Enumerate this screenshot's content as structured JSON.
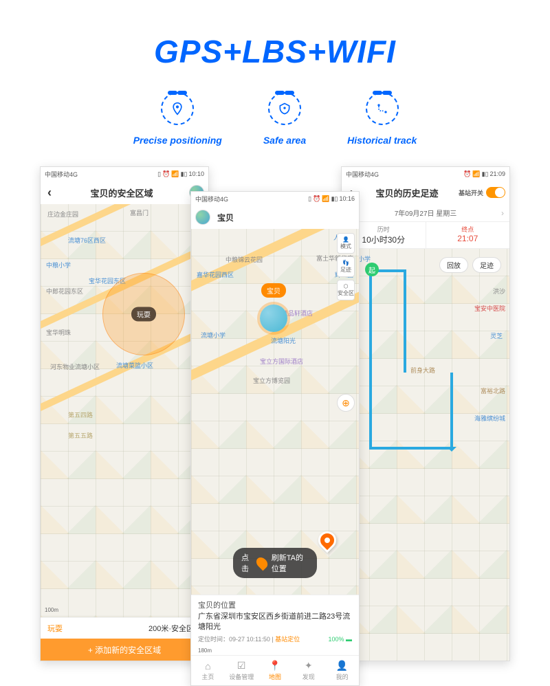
{
  "hero": {
    "title": "GPS+LBS+WIFI"
  },
  "features": [
    {
      "label": "Precise positioning"
    },
    {
      "label": "Safe area"
    },
    {
      "label": "Historical track"
    }
  ],
  "phone_left": {
    "status": {
      "carrier": "中国移动4G",
      "time": "10:10"
    },
    "title": "宝贝的安全区域",
    "map_labels": [
      "庄边金庄园",
      "富昌门",
      "流塘76区西区",
      "中粮小学",
      "中郎花园东区",
      "宝华花园东区",
      "宝华明珠",
      "河东物业流塘小区",
      "流塘菜篮小区",
      "第五四路",
      "第五五路"
    ],
    "pin_label": "玩耍",
    "scale": "100m",
    "zone": {
      "name": "玩耍",
      "desc": "200米·安全区域"
    },
    "add_btn": "+ 添加新的安全区域"
  },
  "phone_center": {
    "status": {
      "carrier": "中国移动4G",
      "time": "10:16"
    },
    "avatar_name": "宝贝",
    "map_labels": [
      "人人乐",
      "嘉华花园西区",
      "中粮锦云花园",
      "流塘小学",
      "宝贝",
      "桂品轩酒店",
      "流塘阳光",
      "宝立方国际酒店",
      "宝立方博览园",
      "辉公园",
      "富土华新华府"
    ],
    "dev_bubble": "宝贝",
    "side_ctrls": [
      "模式",
      "足迹",
      "安全区"
    ],
    "refresh_pill": {
      "left": "点击",
      "right": "刷新TA的位置"
    },
    "addr": {
      "title": "宝贝的位置",
      "text": "广东省深圳市宝安区西乡街道前进二路23号流塘阳光",
      "time_label": "定位时间：",
      "time_val": "09-27 10:11:50",
      "lbs": "基站定位",
      "battery": "100%"
    },
    "scale": "180m",
    "tabs": [
      "主页",
      "设备管理",
      "地图",
      "发现",
      "我的"
    ]
  },
  "phone_right": {
    "status": {
      "carrier": "中国移动4G",
      "time": "21:09"
    },
    "title": "宝贝的历史足迹",
    "toggle_label": "基站开关",
    "date": "7年09月27日 星期三",
    "stat": {
      "dur_lbl": "历时",
      "dur_val": "10小时30分",
      "end_lbl": "终点",
      "end_val": "21:07"
    },
    "chips": [
      "回放",
      "足迹"
    ],
    "start_badge": "起",
    "map_labels": [
      "流塘小学",
      "宝安中医院",
      "洪沙",
      "灵芝",
      "前身大路",
      "富裕北路",
      "海雅缤纷城"
    ]
  }
}
